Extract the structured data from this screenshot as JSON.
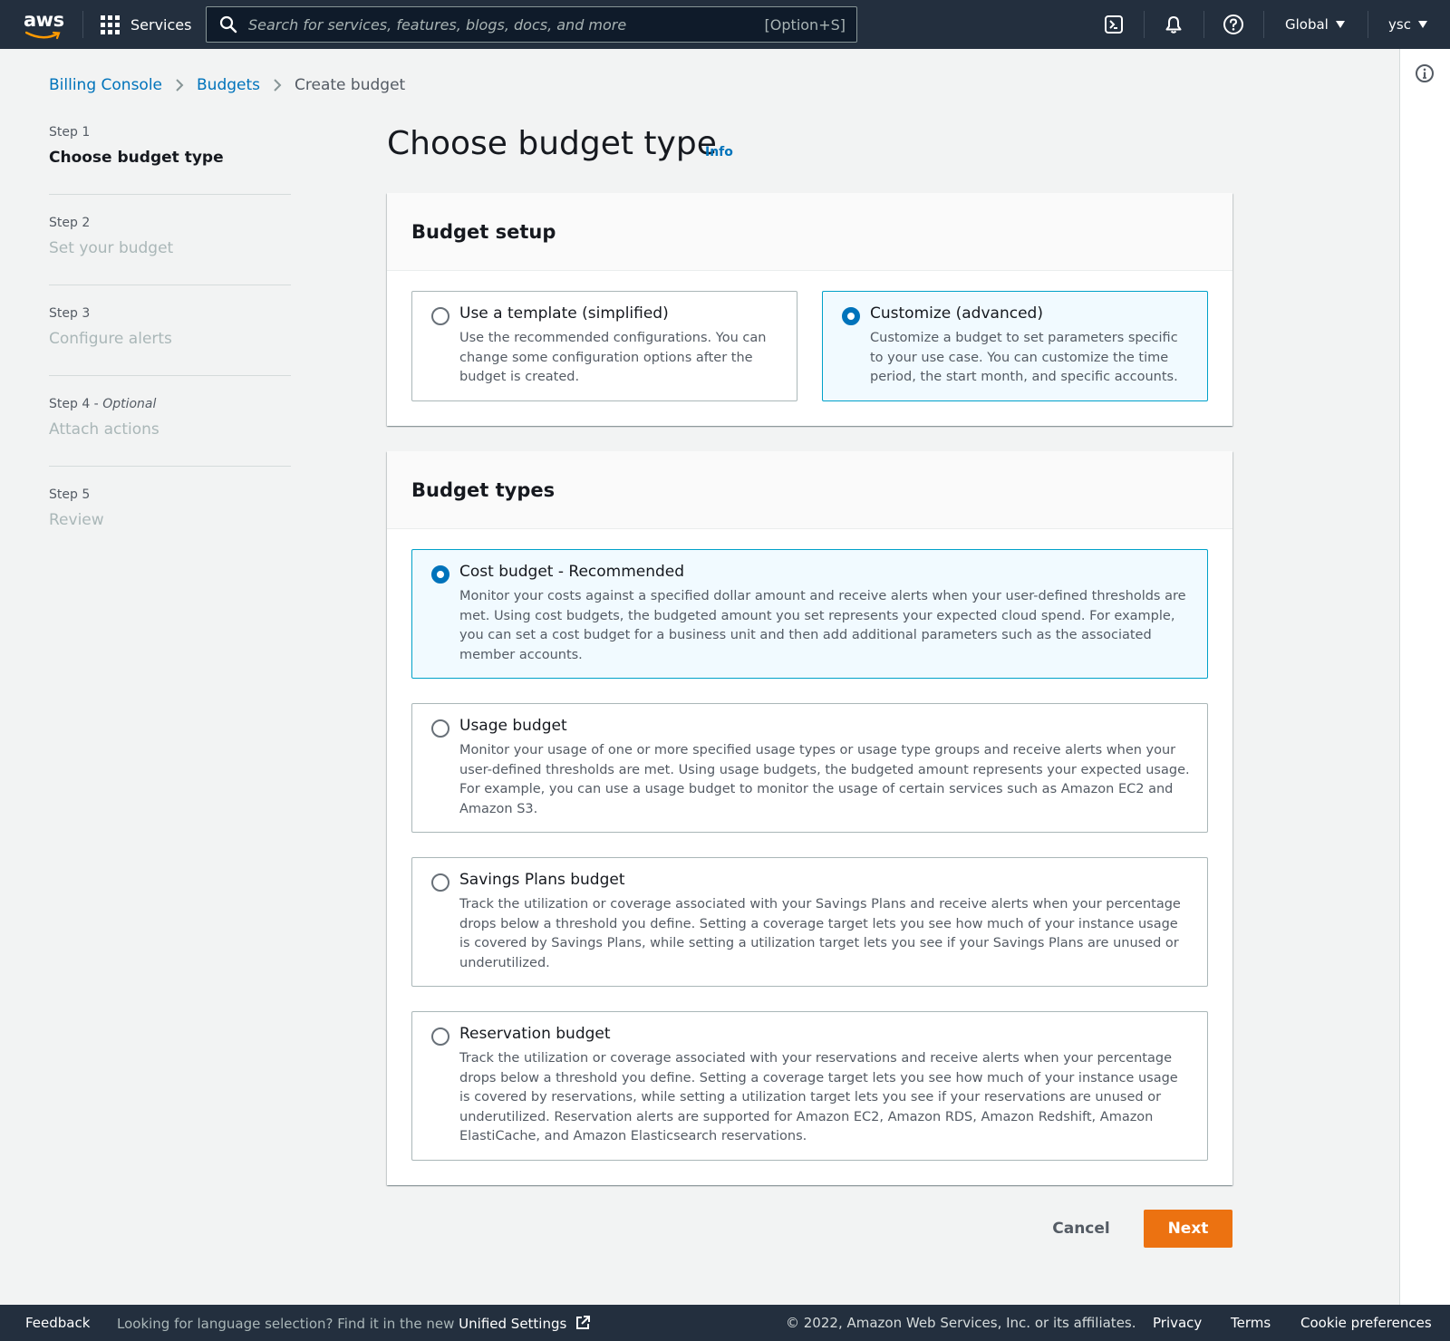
{
  "topnav": {
    "logo_text": "aws",
    "services_label": "Services",
    "search_placeholder": "Search for services, features, blogs, docs, and more",
    "search_shortcut": "[Option+S]",
    "region_label": "Global",
    "user_label": "ysc"
  },
  "breadcrumb": {
    "items": [
      "Billing Console",
      "Budgets"
    ],
    "current": "Create budget"
  },
  "steps": [
    {
      "label": "Step 1",
      "title": "Choose budget type",
      "active": true
    },
    {
      "label": "Step 2",
      "title": "Set your budget"
    },
    {
      "label": "Step 3",
      "title": "Configure alerts"
    },
    {
      "label": "Step 4 - ",
      "optional": "Optional",
      "title": "Attach actions"
    },
    {
      "label": "Step 5",
      "title": "Review"
    }
  ],
  "page": {
    "title": "Choose budget type",
    "info": "Info"
  },
  "budget_setup": {
    "heading": "Budget setup",
    "options": [
      {
        "title": "Use a template (simplified)",
        "desc": "Use the recommended configurations. You can change some configuration options after the budget is created.",
        "selected": false
      },
      {
        "title": "Customize (advanced)",
        "desc": "Customize a budget to set parameters specific to your use case. You can customize the time period, the start month, and specific accounts.",
        "selected": true
      }
    ]
  },
  "budget_types": {
    "heading": "Budget types",
    "options": [
      {
        "title": "Cost budget - Recommended",
        "desc": "Monitor your costs against a specified dollar amount and receive alerts when your user-defined thresholds are met. Using cost budgets, the budgeted amount you set represents your expected cloud spend. For example, you can set a cost budget for a business unit and then add additional parameters such as the associated member accounts.",
        "selected": true
      },
      {
        "title": "Usage budget",
        "desc": "Monitor your usage of one or more specified usage types or usage type groups and receive alerts when your user-defined thresholds are met. Using usage budgets, the budgeted amount represents your expected usage. For example, you can use a usage budget to monitor the usage of certain services such as Amazon EC2 and Amazon S3.",
        "selected": false
      },
      {
        "title": "Savings Plans budget",
        "desc": "Track the utilization or coverage associated with your Savings Plans and receive alerts when your percentage drops below a threshold you define. Setting a coverage target lets you see how much of your instance usage is covered by Savings Plans, while setting a utilization target lets you see if your Savings Plans are unused or underutilized.",
        "selected": false
      },
      {
        "title": "Reservation budget",
        "desc": "Track the utilization or coverage associated with your reservations and receive alerts when your percentage drops below a threshold you define. Setting a coverage target lets you see how much of your instance usage is covered by reservations, while setting a utilization target lets you see if your reservations are unused or underutilized. Reservation alerts are supported for Amazon EC2, Amazon RDS, Amazon Redshift, Amazon ElastiCache, and Amazon Elasticsearch reservations.",
        "selected": false
      }
    ]
  },
  "actions": {
    "cancel": "Cancel",
    "next": "Next"
  },
  "footer": {
    "feedback": "Feedback",
    "lang_text": "Looking for language selection? Find it in the new ",
    "unified_settings": "Unified Settings",
    "copyright": "© 2022, Amazon Web Services, Inc. or its affiliates.",
    "privacy": "Privacy",
    "terms": "Terms",
    "cookie": "Cookie preferences"
  },
  "colors": {
    "nav_bg": "#232f3e",
    "accent": "#ec7211",
    "link": "#0073bb",
    "selected_border": "#00a1c9"
  }
}
